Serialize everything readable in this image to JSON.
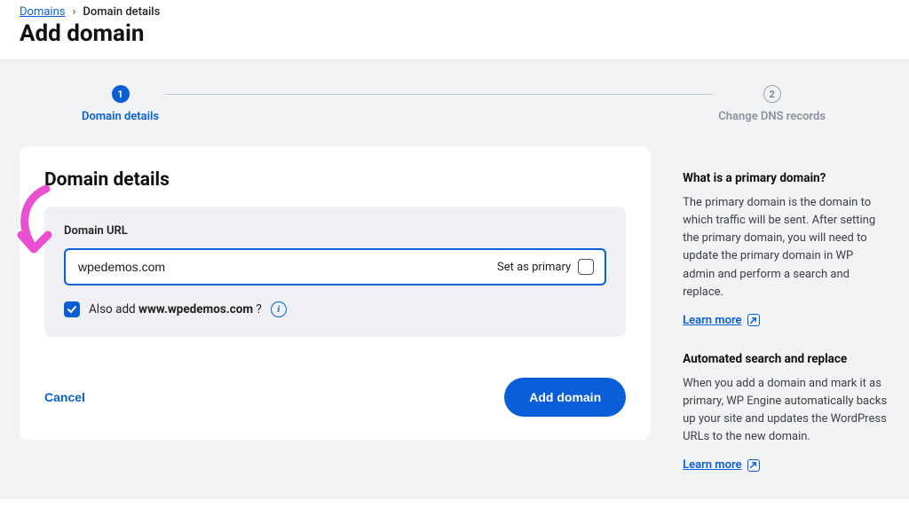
{
  "breadcrumb": {
    "root": "Domains",
    "current": "Domain details"
  },
  "page_title": "Add domain",
  "stepper": {
    "step1": {
      "num": "1",
      "label": "Domain details"
    },
    "step2": {
      "num": "2",
      "label": "Change DNS records"
    }
  },
  "card": {
    "title": "Domain details",
    "field_label": "Domain URL",
    "input_value": "wpedemos.com",
    "set_primary_label": "Set as primary",
    "also_add_prefix": "Also add ",
    "also_add_domain": "www.wpedemos.com",
    "also_add_suffix": " ?"
  },
  "actions": {
    "cancel": "Cancel",
    "submit": "Add domain"
  },
  "sidebar": {
    "s1_heading": "What is a primary domain?",
    "s1_text": "The primary domain is the domain to which traffic will be sent. After setting the primary domain, you will need to update the primary domain in WP admin and perform a search and replace.",
    "s1_link": "Learn more",
    "s2_heading": "Automated search and replace",
    "s2_text": "When you add a domain and mark it as primary, WP Engine automatically backs up your site and updates the WordPress URLs to the new domain.",
    "s2_link": "Learn more"
  }
}
